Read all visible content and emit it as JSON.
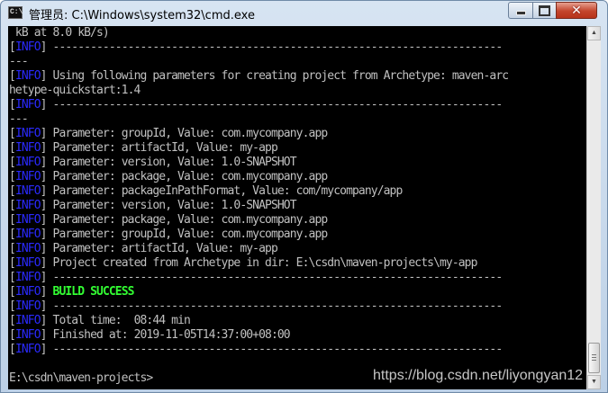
{
  "window": {
    "title": "管理员: C:\\Windows\\system32\\cmd.exe",
    "icon": "cmd-icon",
    "controls": {
      "minimize": "minimize",
      "maximize": "maximize",
      "close": "close"
    }
  },
  "console": {
    "lines": [
      {
        "text": " kB at 8.0 kB/s)"
      },
      {
        "tag": "INFO",
        "text": " ------------------------------------------------------------------------"
      },
      {
        "text": "---"
      },
      {
        "tag": "INFO",
        "text": " Using following parameters for creating project from Archetype: maven-arc"
      },
      {
        "text": "hetype-quickstart:1.4"
      },
      {
        "tag": "INFO",
        "text": " ------------------------------------------------------------------------"
      },
      {
        "text": "---"
      },
      {
        "tag": "INFO",
        "text": " Parameter: groupId, Value: com.mycompany.app"
      },
      {
        "tag": "INFO",
        "text": " Parameter: artifactId, Value: my-app"
      },
      {
        "tag": "INFO",
        "text": " Parameter: version, Value: 1.0-SNAPSHOT"
      },
      {
        "tag": "INFO",
        "text": " Parameter: package, Value: com.mycompany.app"
      },
      {
        "tag": "INFO",
        "text": " Parameter: packageInPathFormat, Value: com/mycompany/app"
      },
      {
        "tag": "INFO",
        "text": " Parameter: version, Value: 1.0-SNAPSHOT"
      },
      {
        "tag": "INFO",
        "text": " Parameter: package, Value: com.mycompany.app"
      },
      {
        "tag": "INFO",
        "text": " Parameter: groupId, Value: com.mycompany.app"
      },
      {
        "tag": "INFO",
        "text": " Parameter: artifactId, Value: my-app"
      },
      {
        "tag": "INFO",
        "text": " Project created from Archetype in dir: E:\\csdn\\maven-projects\\my-app"
      },
      {
        "tag": "INFO",
        "text": " ------------------------------------------------------------------------"
      },
      {
        "tag": "INFO",
        "text": " ",
        "success": "BUILD SUCCESS"
      },
      {
        "tag": "INFO",
        "text": " ------------------------------------------------------------------------"
      },
      {
        "tag": "INFO",
        "text": " Total time:  08:44 min"
      },
      {
        "tag": "INFO",
        "text": " Finished at: 2019-11-05T14:37:00+08:00"
      },
      {
        "tag": "INFO",
        "text": " ------------------------------------------------------------------------"
      },
      {
        "text": ""
      },
      {
        "text": "E:\\csdn\\maven-projects>"
      }
    ],
    "colors": {
      "background": "#000000",
      "text": "#c0c0c0",
      "info_tag": "#2a2aff",
      "success": "#33ff33"
    }
  },
  "watermark": "https://blog.csdn.net/liyongyan12"
}
